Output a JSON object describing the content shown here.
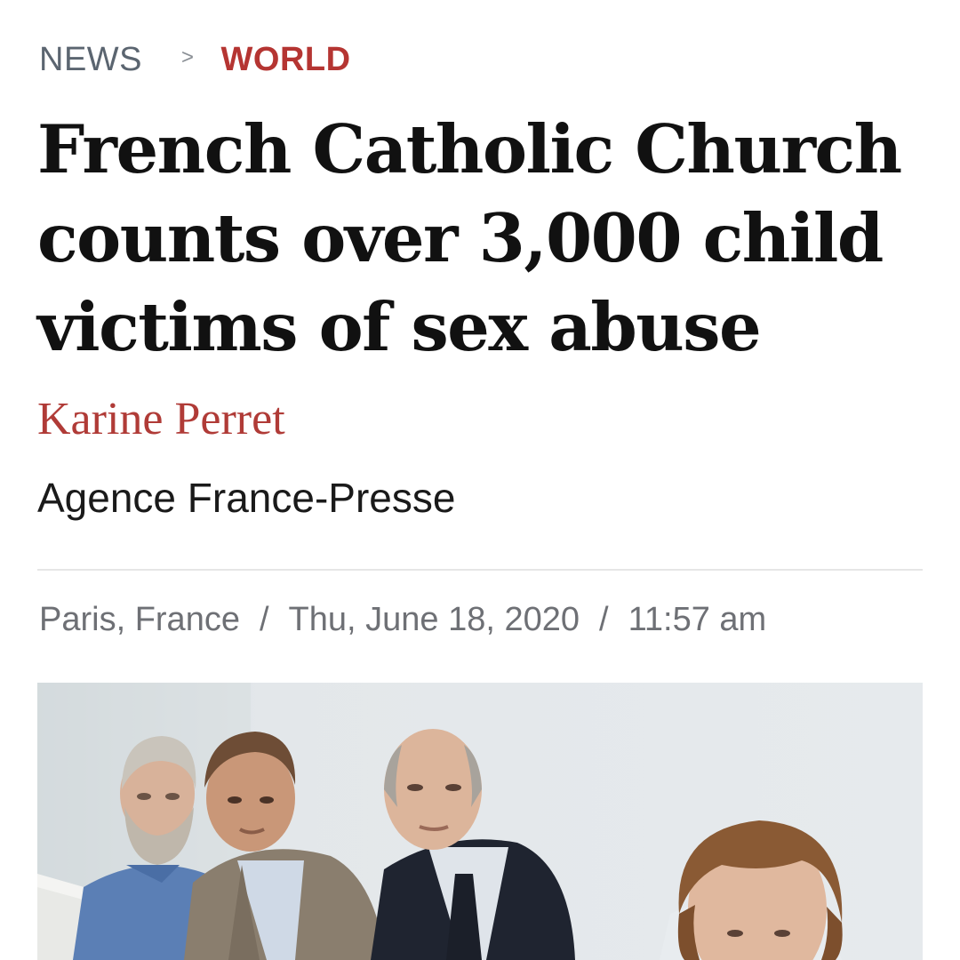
{
  "breadcrumb": {
    "section": "NEWS",
    "separator": ">",
    "subsection": "WORLD"
  },
  "article": {
    "headline_lines": [
      "French Catholic Church",
      "counts over 3,000 child",
      "victims of sex abuse"
    ],
    "author": "Karine Perret",
    "agency": "Agence France-Presse",
    "location": "Paris, France",
    "date": "Thu, June 18, 2020",
    "time": "11:57 am",
    "meta_separator": "/"
  },
  "photo": {
    "subject": "four-people-at-press-conference"
  },
  "colors": {
    "accent": "#b53532",
    "headline": "#111111",
    "meta": "#6e7075",
    "breadcrumb": "#5b6570"
  }
}
